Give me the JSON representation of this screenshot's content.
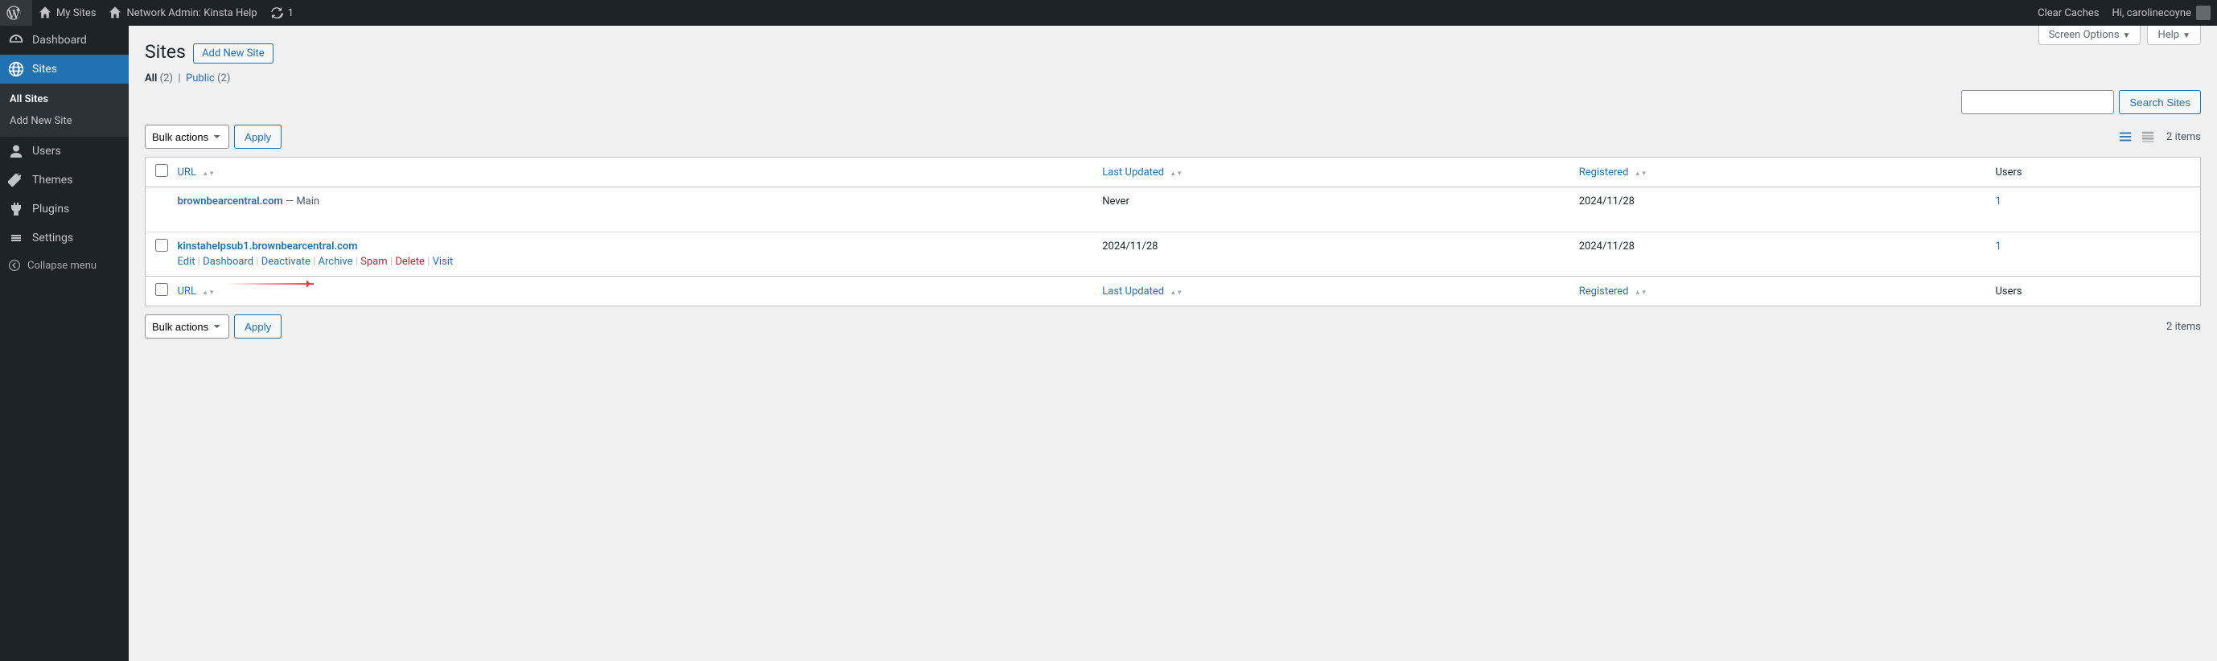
{
  "adminbar": {
    "my_sites": "My Sites",
    "network_admin": "Network Admin: Kinsta Help",
    "updates_count": "1",
    "clear_caches": "Clear Caches",
    "greeting": "Hi, carolinecoyne"
  },
  "adminmenu": {
    "dashboard": "Dashboard",
    "sites": "Sites",
    "sites_sub": {
      "all": "All Sites",
      "add": "Add New Site"
    },
    "users": "Users",
    "themes": "Themes",
    "plugins": "Plugins",
    "settings": "Settings",
    "collapse": "Collapse menu"
  },
  "screen_meta": {
    "screen_options": "Screen Options",
    "help": "Help"
  },
  "page": {
    "title": "Sites",
    "add_new": "Add New Site"
  },
  "filters": {
    "all_label": "All",
    "all_count": "(2)",
    "public_label": "Public",
    "public_count": "(2)"
  },
  "search": {
    "button": "Search Sites"
  },
  "bulk": {
    "placeholder": "Bulk actions",
    "apply": "Apply"
  },
  "pagination": {
    "items": "2 items"
  },
  "table": {
    "headers": {
      "url": "URL",
      "last_updated": "Last Updated",
      "registered": "Registered",
      "users": "Users"
    },
    "rows": [
      {
        "url": "brownbearcentral.com",
        "main_suffix": " — Main",
        "last_updated": "Never",
        "registered": "2024/11/28",
        "users": "1",
        "selectable": false,
        "show_actions": false
      },
      {
        "url": "kinstahelpsub1.brownbearcentral.com",
        "main_suffix": "",
        "last_updated": "2024/11/28",
        "registered": "2024/11/28",
        "users": "1",
        "selectable": true,
        "show_actions": true
      }
    ],
    "actions": {
      "edit": "Edit",
      "dashboard": "Dashboard",
      "deactivate": "Deactivate",
      "archive": "Archive",
      "spam": "Spam",
      "delete": "Delete",
      "visit": "Visit"
    }
  }
}
